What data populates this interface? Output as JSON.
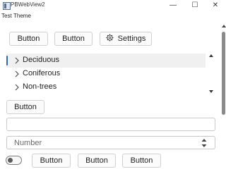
{
  "window": {
    "title": "PBWebView2",
    "minimize": "—",
    "maximize": "☐",
    "close": "✕"
  },
  "menu": [
    "Test",
    "Theme"
  ],
  "top_buttons": {
    "button1": "Button",
    "button2": "Button",
    "settings": "Settings"
  },
  "tree": {
    "items": [
      {
        "label": "Deciduous",
        "selected": true
      },
      {
        "label": "Coniferous",
        "selected": false
      },
      {
        "label": "Non-trees",
        "selected": false
      }
    ]
  },
  "middle_button": "Button",
  "text_input": {
    "value": "",
    "placeholder": ""
  },
  "number_input": {
    "placeholder": "Number"
  },
  "toggle": {
    "on": false
  },
  "bottom_buttons": [
    "Button",
    "Button",
    "Button"
  ],
  "colors": {
    "accent": "#2f6ab3",
    "selection_bg": "#f0f0f0",
    "border": "#d0d0d0"
  }
}
